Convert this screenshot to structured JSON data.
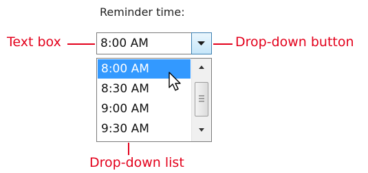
{
  "caption": "Reminder time:",
  "textbox": {
    "value": "8:00 AM"
  },
  "dropdown": {
    "items": [
      "8:00 AM",
      "8:30 AM",
      "9:00 AM",
      "9:30 AM"
    ],
    "selected_index": 0
  },
  "annotations": {
    "text_box": "Text box",
    "dropdown_button": "Drop-down button",
    "dropdown_list": "Drop-down list"
  },
  "colors": {
    "annotation": "#e3001b",
    "selection": "#3399ff"
  },
  "icons": {
    "dropdown_arrow": "chevron-down-icon",
    "scroll_up": "arrow-up-icon",
    "scroll_down": "arrow-down-icon",
    "scroll_grip": "grip-icon",
    "cursor": "mouse-pointer-icon"
  }
}
